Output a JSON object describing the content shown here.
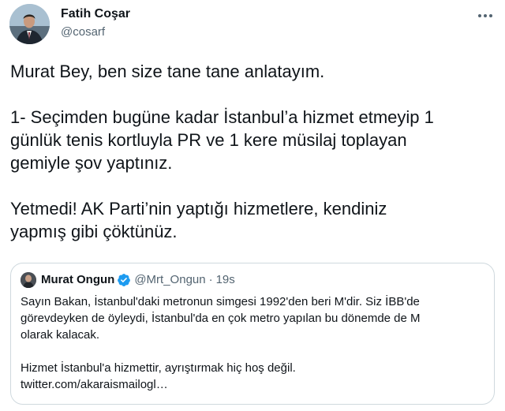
{
  "author": {
    "name": "Fatih Coşar",
    "handle": "@cosarf",
    "avatar_icon": "profile-photo"
  },
  "tweet": {
    "paragraphs": [
      [
        "Murat Bey, ben size tane tane anlatayım."
      ],
      [
        "1- Seçimden bugüne kadar İstanbul’a hizmet etmeyip 1",
        "günlük tenis kortluyla PR ve 1 kere müsilaj toplayan",
        "gemiyle şov yaptınız."
      ],
      [
        "Yetmedi! AK Parti’nin yaptığı hizmetlere, kendiniz",
        "yapmış gibi çöktünüz."
      ]
    ]
  },
  "more_icon": "more-icon",
  "quoted_tweet": {
    "name": "Murat Ongun",
    "verified": true,
    "handle": "@Mrt_Ongun",
    "separator": "·",
    "time": "19s",
    "lines": [
      "Sayın Bakan, İstanbul'daki metronun simgesi 1992'den beri M'dir. Siz İBB'de",
      "görevdeyken de öyleydi, İstanbul'da en çok metro yapılan bu dönemde de M",
      "olarak kalacak.",
      "",
      "Hizmet İstanbul'a hizmettir, ayrıştırmak hiç hoş değil.",
      "twitter.com/akaraismailogl…"
    ]
  },
  "colors": {
    "text": "#0f1419",
    "secondary": "#536471",
    "border": "#cfd9de",
    "verified": "#1d9bf0"
  }
}
